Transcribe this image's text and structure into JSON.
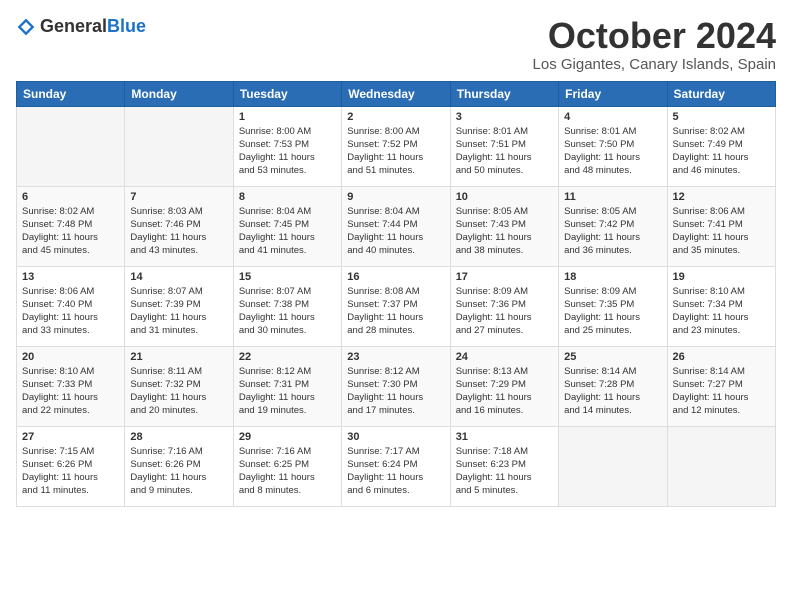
{
  "header": {
    "logo_general": "General",
    "logo_blue": "Blue",
    "month_year": "October 2024",
    "location": "Los Gigantes, Canary Islands, Spain"
  },
  "days_of_week": [
    "Sunday",
    "Monday",
    "Tuesday",
    "Wednesday",
    "Thursday",
    "Friday",
    "Saturday"
  ],
  "weeks": [
    [
      {
        "day": "",
        "info": ""
      },
      {
        "day": "",
        "info": ""
      },
      {
        "day": "1",
        "info": "Sunrise: 8:00 AM\nSunset: 7:53 PM\nDaylight: 11 hours\nand 53 minutes."
      },
      {
        "day": "2",
        "info": "Sunrise: 8:00 AM\nSunset: 7:52 PM\nDaylight: 11 hours\nand 51 minutes."
      },
      {
        "day": "3",
        "info": "Sunrise: 8:01 AM\nSunset: 7:51 PM\nDaylight: 11 hours\nand 50 minutes."
      },
      {
        "day": "4",
        "info": "Sunrise: 8:01 AM\nSunset: 7:50 PM\nDaylight: 11 hours\nand 48 minutes."
      },
      {
        "day": "5",
        "info": "Sunrise: 8:02 AM\nSunset: 7:49 PM\nDaylight: 11 hours\nand 46 minutes."
      }
    ],
    [
      {
        "day": "6",
        "info": "Sunrise: 8:02 AM\nSunset: 7:48 PM\nDaylight: 11 hours\nand 45 minutes."
      },
      {
        "day": "7",
        "info": "Sunrise: 8:03 AM\nSunset: 7:46 PM\nDaylight: 11 hours\nand 43 minutes."
      },
      {
        "day": "8",
        "info": "Sunrise: 8:04 AM\nSunset: 7:45 PM\nDaylight: 11 hours\nand 41 minutes."
      },
      {
        "day": "9",
        "info": "Sunrise: 8:04 AM\nSunset: 7:44 PM\nDaylight: 11 hours\nand 40 minutes."
      },
      {
        "day": "10",
        "info": "Sunrise: 8:05 AM\nSunset: 7:43 PM\nDaylight: 11 hours\nand 38 minutes."
      },
      {
        "day": "11",
        "info": "Sunrise: 8:05 AM\nSunset: 7:42 PM\nDaylight: 11 hours\nand 36 minutes."
      },
      {
        "day": "12",
        "info": "Sunrise: 8:06 AM\nSunset: 7:41 PM\nDaylight: 11 hours\nand 35 minutes."
      }
    ],
    [
      {
        "day": "13",
        "info": "Sunrise: 8:06 AM\nSunset: 7:40 PM\nDaylight: 11 hours\nand 33 minutes."
      },
      {
        "day": "14",
        "info": "Sunrise: 8:07 AM\nSunset: 7:39 PM\nDaylight: 11 hours\nand 31 minutes."
      },
      {
        "day": "15",
        "info": "Sunrise: 8:07 AM\nSunset: 7:38 PM\nDaylight: 11 hours\nand 30 minutes."
      },
      {
        "day": "16",
        "info": "Sunrise: 8:08 AM\nSunset: 7:37 PM\nDaylight: 11 hours\nand 28 minutes."
      },
      {
        "day": "17",
        "info": "Sunrise: 8:09 AM\nSunset: 7:36 PM\nDaylight: 11 hours\nand 27 minutes."
      },
      {
        "day": "18",
        "info": "Sunrise: 8:09 AM\nSunset: 7:35 PM\nDaylight: 11 hours\nand 25 minutes."
      },
      {
        "day": "19",
        "info": "Sunrise: 8:10 AM\nSunset: 7:34 PM\nDaylight: 11 hours\nand 23 minutes."
      }
    ],
    [
      {
        "day": "20",
        "info": "Sunrise: 8:10 AM\nSunset: 7:33 PM\nDaylight: 11 hours\nand 22 minutes."
      },
      {
        "day": "21",
        "info": "Sunrise: 8:11 AM\nSunset: 7:32 PM\nDaylight: 11 hours\nand 20 minutes."
      },
      {
        "day": "22",
        "info": "Sunrise: 8:12 AM\nSunset: 7:31 PM\nDaylight: 11 hours\nand 19 minutes."
      },
      {
        "day": "23",
        "info": "Sunrise: 8:12 AM\nSunset: 7:30 PM\nDaylight: 11 hours\nand 17 minutes."
      },
      {
        "day": "24",
        "info": "Sunrise: 8:13 AM\nSunset: 7:29 PM\nDaylight: 11 hours\nand 16 minutes."
      },
      {
        "day": "25",
        "info": "Sunrise: 8:14 AM\nSunset: 7:28 PM\nDaylight: 11 hours\nand 14 minutes."
      },
      {
        "day": "26",
        "info": "Sunrise: 8:14 AM\nSunset: 7:27 PM\nDaylight: 11 hours\nand 12 minutes."
      }
    ],
    [
      {
        "day": "27",
        "info": "Sunrise: 7:15 AM\nSunset: 6:26 PM\nDaylight: 11 hours\nand 11 minutes."
      },
      {
        "day": "28",
        "info": "Sunrise: 7:16 AM\nSunset: 6:26 PM\nDaylight: 11 hours\nand 9 minutes."
      },
      {
        "day": "29",
        "info": "Sunrise: 7:16 AM\nSunset: 6:25 PM\nDaylight: 11 hours\nand 8 minutes."
      },
      {
        "day": "30",
        "info": "Sunrise: 7:17 AM\nSunset: 6:24 PM\nDaylight: 11 hours\nand 6 minutes."
      },
      {
        "day": "31",
        "info": "Sunrise: 7:18 AM\nSunset: 6:23 PM\nDaylight: 11 hours\nand 5 minutes."
      },
      {
        "day": "",
        "info": ""
      },
      {
        "day": "",
        "info": ""
      }
    ]
  ]
}
